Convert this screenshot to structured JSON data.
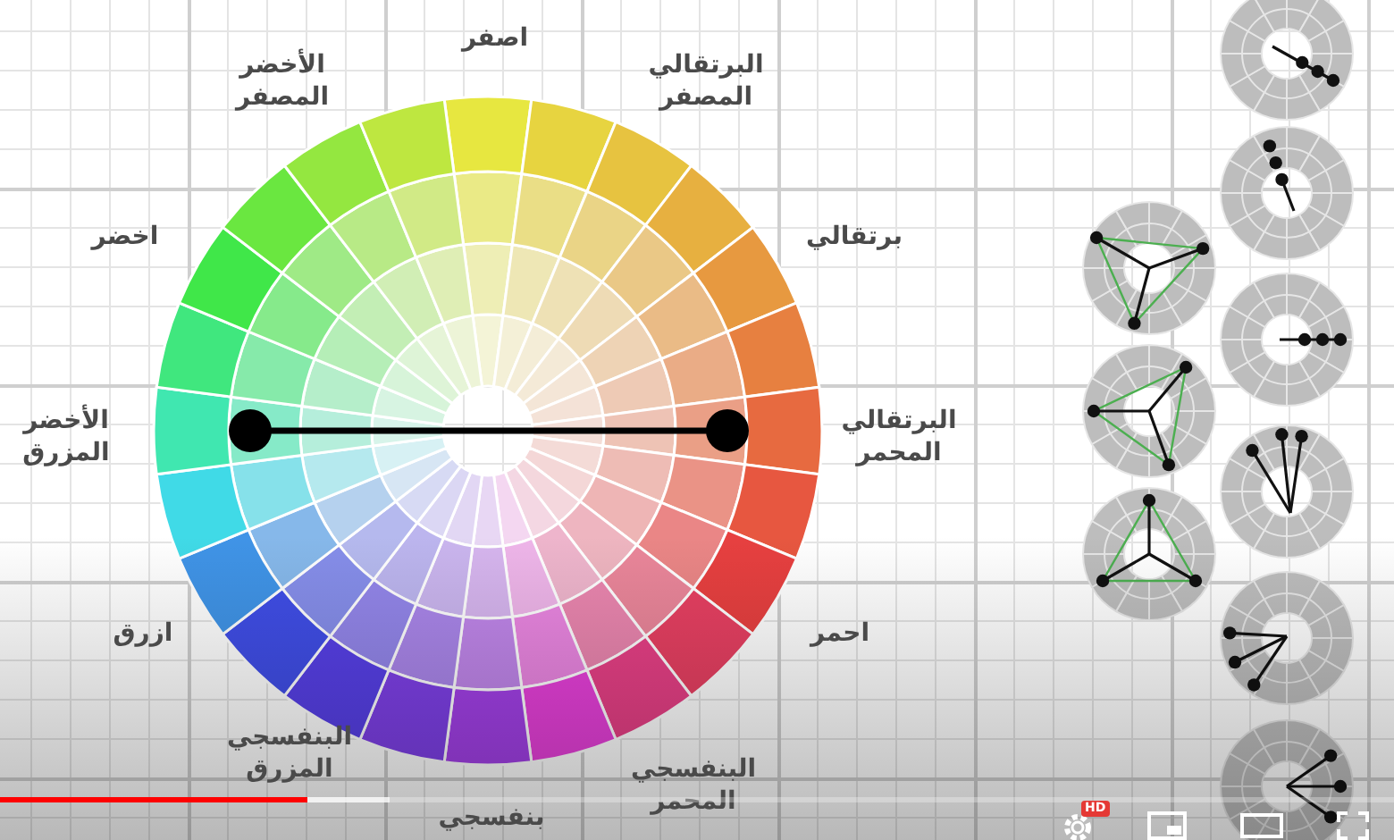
{
  "wheel": {
    "labels": [
      {
        "lines": [
          "البرتقالي",
          "المصفر"
        ]
      },
      {
        "lines": [
          "اصفر"
        ]
      },
      {
        "lines": [
          "الأخضر",
          "المصفر"
        ]
      },
      {
        "lines": [
          "برتقالي"
        ]
      },
      {
        "lines": [
          "اخضر"
        ]
      },
      {
        "lines": [
          "البرتقالي",
          "المحمر"
        ]
      },
      {
        "lines": [
          "الأخضر",
          "المزرق"
        ]
      },
      {
        "lines": [
          "احمر"
        ]
      },
      {
        "lines": [
          "ازرق"
        ]
      },
      {
        "lines": [
          "البنفسجي",
          "المحمر"
        ]
      },
      {
        "lines": [
          "بنفسجي"
        ]
      },
      {
        "lines": [
          "البنفسجي",
          "المزرق"
        ]
      }
    ]
  },
  "player": {
    "progress": {
      "level": 0.22
    },
    "buffered": {
      "level": 0.28
    },
    "hd_badge": "HD"
  }
}
